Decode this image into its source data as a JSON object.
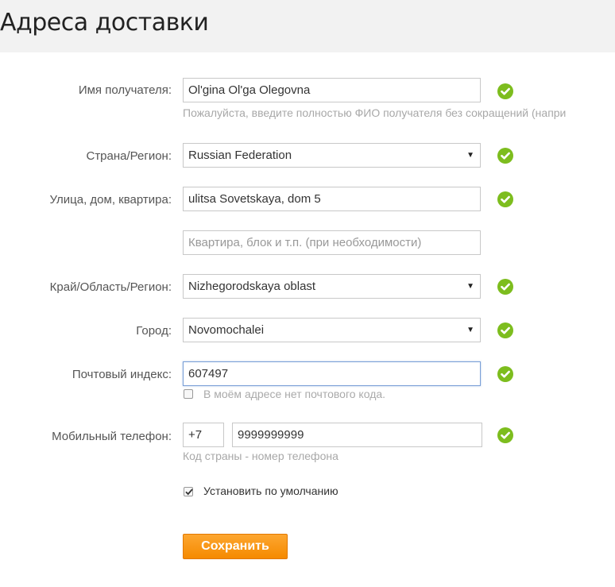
{
  "page": {
    "title": "Адреса доставки"
  },
  "form": {
    "recipient": {
      "label": "Имя получателя:",
      "value": "Ol'gina Ol'ga Olegovna",
      "hint": "Пожалуйста, введите полностью ФИО получателя без сокращений (напри"
    },
    "country": {
      "label": "Страна/Регион:",
      "value": "Russian Federation"
    },
    "street": {
      "label": "Улица, дом, квартира:",
      "value": "ulitsa Sovetskaya, dom 5",
      "placeholder2": "Квартира, блок и т.п. (при необходимости)"
    },
    "region": {
      "label": "Край/Область/Регион:",
      "value": "Nizhegorodskaya oblast"
    },
    "city": {
      "label": "Город:",
      "value": "Novomochalei"
    },
    "zip": {
      "label": "Почтовый индекс:",
      "value": "607497",
      "no_zip_label": "В моём адресе нет почтового кода.",
      "no_zip_checked": false
    },
    "phone": {
      "label": "Мобильный телефон:",
      "country_code": "+7",
      "number": "9999999999",
      "hint": "Код страны - номер телефона"
    },
    "default": {
      "label": "Установить по умолчанию",
      "checked": true
    },
    "save_label": "Сохранить"
  },
  "colors": {
    "valid": "#7dbd1e",
    "accent": "#f58a00"
  },
  "icons": {
    "valid": "check-circle-icon",
    "dropdown": "triangle-down-icon"
  }
}
